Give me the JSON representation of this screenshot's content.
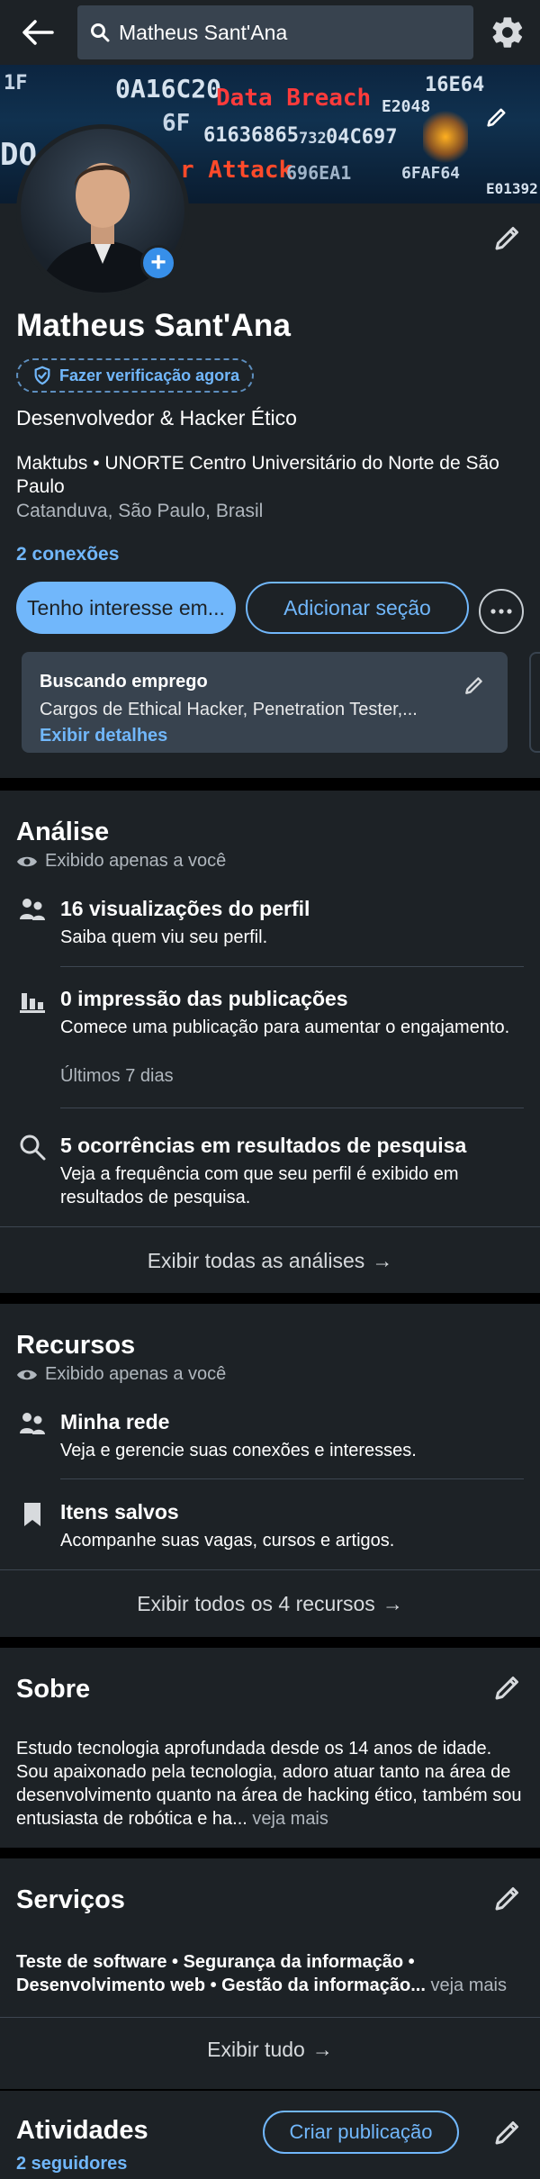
{
  "topbar": {
    "search_value": "Matheus Sant'Ana",
    "back_icon": "arrow-left-icon",
    "settings_icon": "gear-icon"
  },
  "cover": {
    "fragments": [
      {
        "text": "1F",
        "color": "#c7d6e6"
      },
      {
        "text": "0A16C20",
        "color": "#d6e2ee"
      },
      {
        "text": "Data Breach",
        "color": "#ff3b3b"
      },
      {
        "text": "E2048",
        "color": "#d6e2ee"
      },
      {
        "text": "16E64",
        "color": "#d6e2ee"
      },
      {
        "text": "6F",
        "color": "#c7d6e6"
      },
      {
        "text": "61636865",
        "color": "#d6e2ee"
      },
      {
        "text": "732",
        "color": "#c7d6e6"
      },
      {
        "text": "04C697",
        "color": "#d6e2ee"
      },
      {
        "text": "DO",
        "color": "#d6e2ee"
      },
      {
        "text": "r Attack",
        "color": "#ff4a2a"
      },
      {
        "text": "696EA1",
        "color": "#9fb3c8"
      },
      {
        "text": "6FAF64",
        "color": "#c7d6e6"
      },
      {
        "text": "E01392",
        "color": "#d6e2ee"
      }
    ]
  },
  "profile": {
    "name": "Matheus Sant'Ana",
    "verify_label": "Fazer verificação agora",
    "headline": "Desenvolvedor & Hacker Ético",
    "education": "Maktubs • UNORTE Centro Universitário do Norte de São Paulo",
    "location": "Catanduva, São Paulo, Brasil",
    "connections": "2 conexões",
    "btn_interest": "Tenho interesse em...",
    "btn_add_section": "Adicionar seção",
    "job_card": {
      "title": "Buscando emprego",
      "roles": "Cargos de Ethical Hacker, Penetration Tester,...",
      "details_link": "Exibir detalhes"
    }
  },
  "analytics": {
    "title": "Análise",
    "visibility": "Exibido apenas a você",
    "items": [
      {
        "title": "16 visualizações do perfil",
        "desc": "Saiba quem viu seu perfil.",
        "icon": "people-icon"
      },
      {
        "title": "0 impressão das publicações",
        "desc": "Comece uma publicação para aumentar o engajamento.",
        "sub": "Últimos 7 dias",
        "icon": "bar-chart-icon"
      },
      {
        "title": "5 ocorrências em resultados de pesquisa",
        "desc": "Veja a frequência com que seu perfil é exibido em resultados de pesquisa.",
        "icon": "search-icon"
      }
    ],
    "show_all": "Exibir todas as análises"
  },
  "resources": {
    "title": "Recursos",
    "visibility": "Exibido apenas a você",
    "items": [
      {
        "title": "Minha rede",
        "desc": "Veja e gerencie suas conexões e interesses.",
        "icon": "people-icon"
      },
      {
        "title": "Itens salvos",
        "desc": "Acompanhe suas vagas, cursos e artigos.",
        "icon": "bookmark-icon"
      }
    ],
    "show_all": "Exibir todos os 4 recursos"
  },
  "about": {
    "title": "Sobre",
    "text": "Estudo tecnologia aprofundada desde os 14 anos de idade. Sou apaixonado pela tecnologia, adoro atuar tanto na área de desenvolvimento quanto na área de hacking ético, também sou entusiasta de robótica e ha...",
    "see_more": "veja mais"
  },
  "services": {
    "title": "Serviços",
    "text": "Teste de software • Segurança da informação • Desenvolvimento web • Gestão da informação...",
    "see_more": "veja mais",
    "show_all": "Exibir tudo"
  },
  "activity": {
    "title": "Atividades",
    "create_post": "Criar publicação",
    "followers": "2 seguidores"
  },
  "colors": {
    "card_bg": "#1d2226",
    "link_blue": "#71b7fb",
    "accent_blue": "#378fe9",
    "breach_red": "#ff3b3b"
  }
}
